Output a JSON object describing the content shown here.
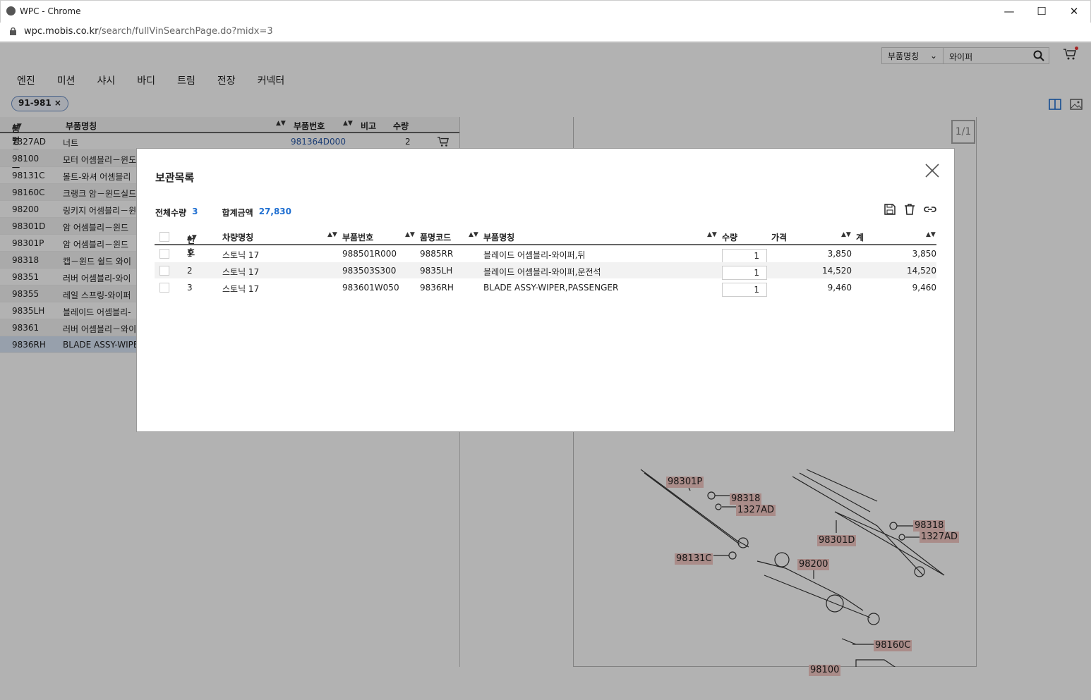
{
  "window": {
    "title": "WPC - Chrome",
    "url_host": "wpc.mobis.co.kr",
    "url_path": "/search/fullVinSearchPage.do?midx=3"
  },
  "search": {
    "type_value": "부품명칭",
    "query": "와이퍼"
  },
  "nav": [
    "엔진",
    "미션",
    "샤시",
    "바디",
    "트림",
    "전장",
    "커넥터"
  ],
  "filter_chip": "91-981",
  "left_table": {
    "headers": {
      "code": "품명코드",
      "name": "부품명칭",
      "part_no": "부품번호",
      "note": "비고",
      "qty": "수량"
    },
    "rows": [
      {
        "code": "1327AD",
        "name": "너트",
        "part_no": "981364D000",
        "qty": "2"
      },
      {
        "code": "98100",
        "name": "모터 어셈블리－윈도"
      },
      {
        "code": "98131C",
        "name": "볼트-와셔 어셈블리"
      },
      {
        "code": "98160C",
        "name": "크랭크 암－윈드실드"
      },
      {
        "code": "98200",
        "name": "링키지 어셈블리－윈"
      },
      {
        "code": "98301D",
        "name": "암 어셈블리－윈드"
      },
      {
        "code": "98301P",
        "name": "암 어셈블리－윈드"
      },
      {
        "code": "98318",
        "name": "캡－윈드 쉴드 와이"
      },
      {
        "code": "98351",
        "name": "러버 어셈블리-와이"
      },
      {
        "code": "98355",
        "name": "레일 스프링-와이퍼"
      },
      {
        "code": "9835LH",
        "name": "블레이드 어셈블리-"
      },
      {
        "code": "98361",
        "name": "러버 어셈블리－와이"
      },
      {
        "code": "9836RH",
        "name": "BLADE ASSY-WIPE"
      }
    ]
  },
  "diagram": {
    "page": "1/1",
    "callouts": [
      "98301P",
      "98318",
      "1327AD",
      "98318",
      "1327AD",
      "98301D",
      "98131C",
      "98200",
      "98160C",
      "98100"
    ]
  },
  "modal": {
    "title": "보관목록",
    "total_qty_label": "전체수량",
    "total_qty": "3",
    "total_amount_label": "합계금액",
    "total_amount": "27,830",
    "headers": {
      "no": "번호",
      "vehicle": "차량명칭",
      "part_no": "부품번호",
      "code": "품명코드",
      "name": "부품명칭",
      "qty": "수량",
      "price": "가격",
      "sum": "계"
    },
    "rows": [
      {
        "no": "1",
        "vehicle": "스토닉 17",
        "part_no": "988501R000",
        "code": "9885RR",
        "name": "블레이드 어셈블리-와이퍼,뒤",
        "qty": "1",
        "price": "3,850",
        "sum": "3,850"
      },
      {
        "no": "2",
        "vehicle": "스토닉 17",
        "part_no": "983503S300",
        "code": "9835LH",
        "name": "블레이드 어셈블리-와이퍼,운전석",
        "qty": "1",
        "price": "14,520",
        "sum": "14,520"
      },
      {
        "no": "3",
        "vehicle": "스토닉 17",
        "part_no": "983601W050",
        "code": "9836RH",
        "name": "BLADE ASSY-WIPER,PASSENGER",
        "qty": "1",
        "price": "9,460",
        "sum": "9,460"
      }
    ]
  },
  "colors": {
    "accent": "#1f6fd1",
    "callout": "#f4c9c4",
    "selected_row": "#d9e6f7"
  }
}
